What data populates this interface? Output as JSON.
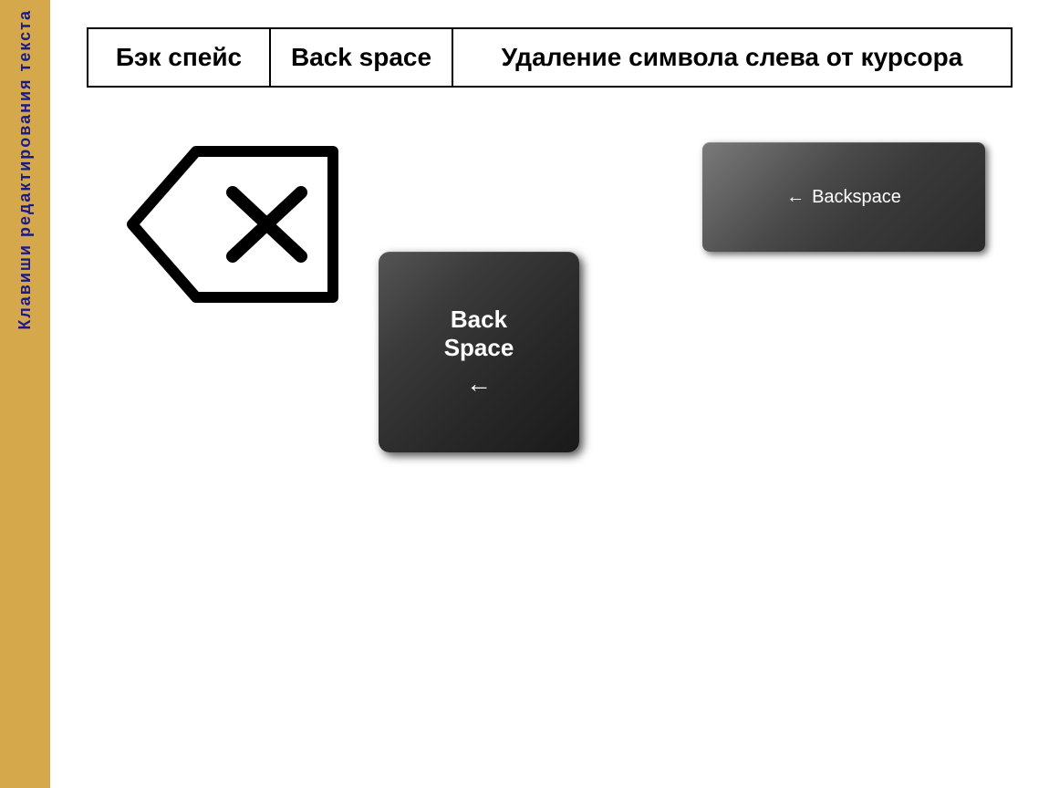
{
  "sidebar": {
    "text": "Клавиши редактирования текста"
  },
  "table": {
    "col1": "Бэк спейс",
    "col2": "Back space",
    "col3": "Удаление символа слева от курсора"
  },
  "keys": {
    "wide_key_text": "Backspace",
    "square_key_line1": "Back",
    "square_key_line2": "Space",
    "arrow_symbol": "←"
  }
}
